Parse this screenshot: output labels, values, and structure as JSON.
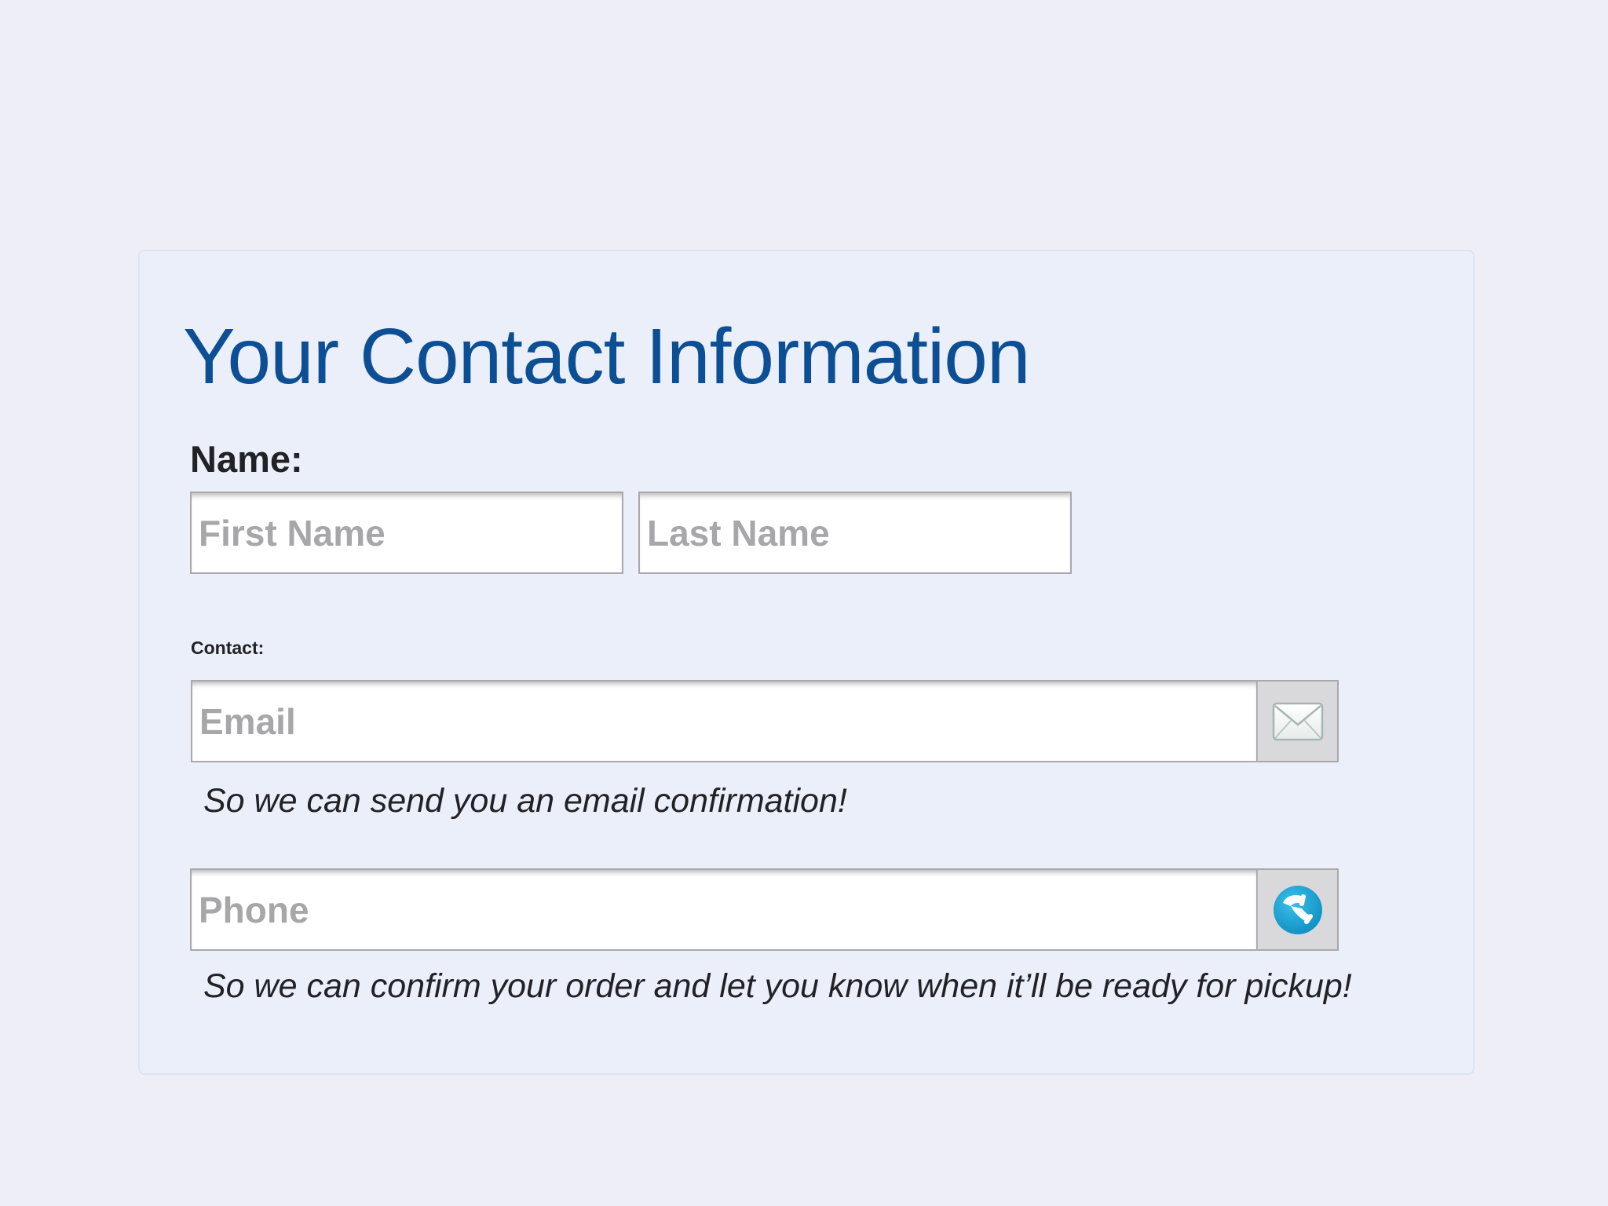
{
  "form": {
    "title": "Your Contact Information",
    "name_label": "Name:",
    "first_name_placeholder": "First Name",
    "last_name_placeholder": "Last Name",
    "contact_label": "Contact:",
    "email_placeholder": "Email",
    "email_hint": "So we can send you an email confirmation!",
    "phone_placeholder": "Phone",
    "phone_hint": "So we can confirm your order and let you know when it’ll be ready for pickup!"
  },
  "icons": {
    "email": "envelope-icon",
    "phone": "phone-icon"
  },
  "colors": {
    "title": "#0d4f94",
    "panel_background": "#ebeff9",
    "page_background": "#eeeef7",
    "placeholder": "#a7a7aa",
    "phone_icon": "#1aa3d3"
  }
}
